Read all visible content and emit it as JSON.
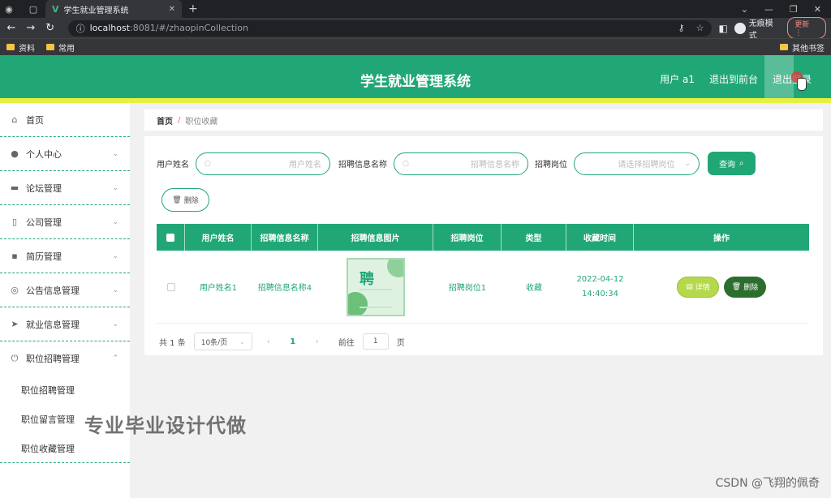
{
  "browser": {
    "tab_title": "学生就业管理系统",
    "url_host": "localhost",
    "url_path": ":8081/#/zhaopinCollection",
    "incognito_label": "无痕模式",
    "update_label": "更新",
    "bookmarks": [
      "资料",
      "常用"
    ],
    "bookmarks_other": "其他书签"
  },
  "header": {
    "title": "学生就业管理系统",
    "user": "用户 a1",
    "exit_front": "退出到前台",
    "logout": "退出登录"
  },
  "sidebar": {
    "items": [
      {
        "label": "首页",
        "icon": "home-icon"
      },
      {
        "label": "个人中心",
        "icon": "user-icon"
      },
      {
        "label": "论坛管理",
        "icon": "forum-icon"
      },
      {
        "label": "公司管理",
        "icon": "company-icon"
      },
      {
        "label": "简历管理",
        "icon": "resume-icon"
      },
      {
        "label": "公告信息管理",
        "icon": "notice-icon"
      },
      {
        "label": "就业信息管理",
        "icon": "send-icon"
      },
      {
        "label": "职位招聘管理",
        "icon": "power-icon"
      }
    ],
    "sub_items": [
      "职位招聘管理",
      "职位留言管理",
      "职位收藏管理"
    ]
  },
  "breadcrumb": {
    "home": "首页",
    "separator": "/",
    "current": "职位收藏"
  },
  "search": {
    "username_label": "用户姓名",
    "username_placeholder": "用户姓名",
    "info_label": "招聘信息名称",
    "info_placeholder": "招聘信息名称",
    "position_label": "招聘岗位",
    "position_placeholder": "请选择招聘岗位",
    "query_button": "查询",
    "delete_button": "删除"
  },
  "table": {
    "columns": [
      "用户姓名",
      "招聘信息名称",
      "招聘信息图片",
      "招聘岗位",
      "类型",
      "收藏时间",
      "操作"
    ],
    "rows": [
      {
        "username": "用户姓名1",
        "info_name": "招聘信息名称4",
        "image_text": "聘",
        "position": "招聘岗位1",
        "type": "收藏",
        "time": "2022-04-12 14:40:34",
        "detail_button": "详情",
        "delete_button": "删除"
      }
    ]
  },
  "pagination": {
    "total": "共 1 条",
    "page_size": "10条/页",
    "current_page": "1",
    "goto_label": "前往",
    "goto_value": "1",
    "page_suffix": "页"
  },
  "watermarks": {
    "overlay": "专业毕业设计代做",
    "csdn": "CSDN @飞翔的佩奇"
  },
  "colors": {
    "primary": "#21a776",
    "accent": "#e6f13f",
    "detail_button": "#b5d94a",
    "delete_button": "#2c6e2e"
  }
}
